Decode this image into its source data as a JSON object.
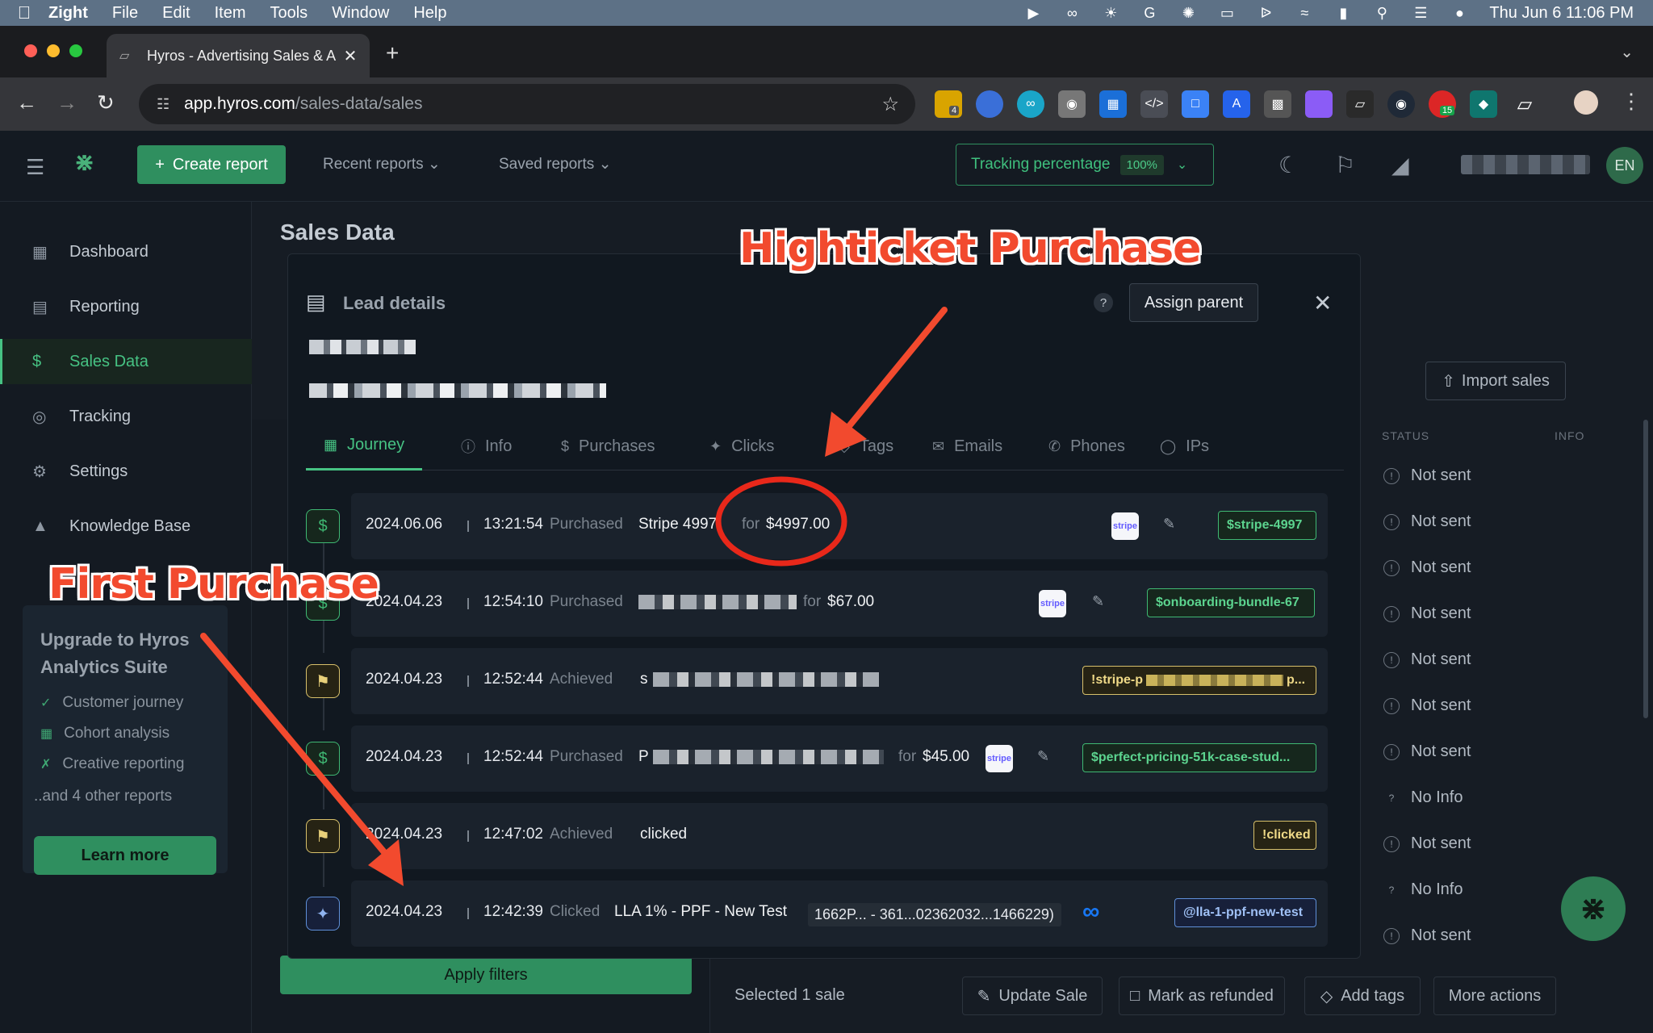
{
  "menubar": {
    "app_name": "Zight",
    "items": [
      "File",
      "Edit",
      "Item",
      "Tools",
      "Window",
      "Help"
    ],
    "clock": "Thu Jun 6  11:06 PM"
  },
  "browser": {
    "tab_title": "Hyros - Advertising Sales & A",
    "url_host": "app.hyros.com",
    "url_path": "/sales-data/sales",
    "ext_badges": {
      "first": "4",
      "second": "15"
    }
  },
  "header": {
    "create_report": "Create report",
    "recent_reports": "Recent reports",
    "saved_reports": "Saved reports",
    "tracking_label": "Tracking percentage",
    "tracking_value": "100%",
    "avatar_initials": "EN"
  },
  "sidebar": {
    "items": [
      {
        "label": "Dashboard",
        "icon": "grid-icon"
      },
      {
        "label": "Reporting",
        "icon": "chart-icon"
      },
      {
        "label": "Sales Data",
        "icon": "dollar-icon"
      },
      {
        "label": "Tracking",
        "icon": "target-icon"
      },
      {
        "label": "Settings",
        "icon": "gear-icon"
      },
      {
        "label": "Knowledge Base",
        "icon": "graduation-cap-icon"
      }
    ],
    "upgrade": {
      "title_line1": "Upgrade to Hyros",
      "title_line2": "Analytics Suite",
      "features": [
        "Customer journey",
        "Cohort analysis",
        "Creative reporting"
      ],
      "more": "..and 4 other reports",
      "button": "Learn more"
    }
  },
  "main": {
    "page_title": "Sales Data",
    "import_sales": "Import sales",
    "col_status": "STATUS",
    "col_info": "INFO",
    "statuses": [
      "Not sent",
      "Not sent",
      "Not sent",
      "Not sent",
      "Not sent",
      "Not sent",
      "Not sent",
      "No Info",
      "Not sent",
      "No Info",
      "Not sent"
    ],
    "apply_filters": "Apply filters",
    "selected": "Selected 1 sale",
    "actions": {
      "update_sale": "Update Sale",
      "mark_refunded": "Mark as refunded",
      "add_tags": "Add tags",
      "more_actions": "More actions"
    }
  },
  "modal": {
    "title": "Lead details",
    "help": "?",
    "assign_parent": "Assign parent",
    "tabs": [
      {
        "label": "Journey",
        "active": true
      },
      {
        "label": "Info"
      },
      {
        "label": "Purchases"
      },
      {
        "label": "Clicks"
      },
      {
        "label": "Tags"
      },
      {
        "label": "Emails"
      },
      {
        "label": "Phones"
      },
      {
        "label": "IPs"
      }
    ],
    "journey": [
      {
        "date": "2024.06.06",
        "time": "13:21:54",
        "verb": "Purchased",
        "text": "Stripe 4997",
        "for": "for",
        "amount": "$4997.00",
        "tag": "$stripe-4997",
        "type": "purchase"
      },
      {
        "date": "2024.04.23",
        "time": "12:54:10",
        "verb": "Purchased",
        "for": "for",
        "amount": "$67.00",
        "tag": "$onboarding-bundle-67",
        "type": "purchase"
      },
      {
        "date": "2024.04.23",
        "time": "12:52:44",
        "verb": "Achieved",
        "text": "s",
        "tag": "!stripe-p",
        "tag_end": "p...",
        "type": "achieve"
      },
      {
        "date": "2024.04.23",
        "time": "12:52:44",
        "verb": "Purchased",
        "text": "P",
        "for": "for",
        "amount": "$45.00",
        "tag": "$perfect-pricing-51k-case-stud...",
        "type": "purchase"
      },
      {
        "date": "2024.04.23",
        "time": "12:47:02",
        "verb": "Achieved",
        "text": "clicked",
        "tag": "!clicked",
        "type": "achieve"
      },
      {
        "date": "2024.04.23",
        "time": "12:42:39",
        "verb": "Clicked",
        "text": "LLA 1% - PPF - New Test",
        "campaign_id": "1662P... - 361...02362032...1466229)",
        "tag": "@lla-1-ppf-new-test",
        "type": "click"
      }
    ],
    "stripe_label": "stripe"
  },
  "annotations": {
    "highticket": "Highticket Purchase",
    "first": "First Purchase"
  },
  "colors": {
    "brand_green": "#2f8f5f",
    "accent_green": "#46c283",
    "annotation_red": "#f24a2e"
  }
}
